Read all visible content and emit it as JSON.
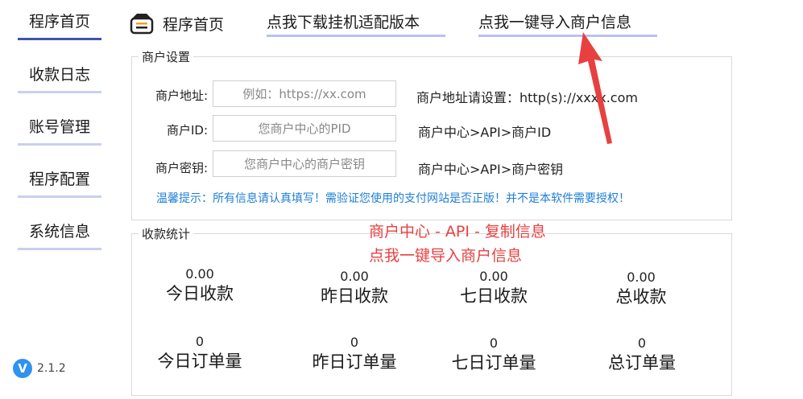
{
  "sidebar": {
    "items": [
      {
        "label": "程序首页",
        "active": true
      },
      {
        "label": "收款日志",
        "active": false
      },
      {
        "label": "账号管理",
        "active": false
      },
      {
        "label": "程序配置",
        "active": false
      },
      {
        "label": "系统信息",
        "active": false
      }
    ],
    "version_badge": "V",
    "version": "2.1.2"
  },
  "topbar": {
    "home_title": "程序首页",
    "download_link": "点我下载挂机适配版本",
    "import_link": "点我一键导入商户信息"
  },
  "merchant": {
    "section_title": "商户设置",
    "address_label": "商户地址:",
    "address_placeholder": "例如：https://xx.com",
    "address_hint": "商户地址请设置：http(s)://xxxx.com",
    "id_label": "商户ID:",
    "id_placeholder": "您商户中心的PID",
    "id_hint": "商户中心>API>商户ID",
    "key_label": "商户密钥:",
    "key_placeholder": "您商户中心的商户密钥",
    "key_hint": "商户中心>API>商户密钥",
    "tip": "温馨提示：所有信息请认真填写！需验证您使用的支付网站是否正版！并不是本软件需要授权！"
  },
  "stats": {
    "section_title": "收款统计",
    "items": [
      {
        "value": "0.00",
        "label": "今日收款"
      },
      {
        "value": "0.00",
        "label": "昨日收款"
      },
      {
        "value": "0.00",
        "label": "七日收款"
      },
      {
        "value": "0.00",
        "label": "总收款"
      },
      {
        "value": "0",
        "label": "今日订单量"
      },
      {
        "value": "0",
        "label": "昨日订单量"
      },
      {
        "value": "0",
        "label": "七日订单量"
      },
      {
        "value": "0",
        "label": "总订单量"
      }
    ]
  },
  "annotation": {
    "line1": "商户中心 - API - 复制信息",
    "line2": "点我一键导入商户信息"
  },
  "colors": {
    "accent": "#3f55a8",
    "underline": "#c9d0ee",
    "tip": "#1e7fd6",
    "annotation": "#e84040",
    "version_badge": "#2f93f0"
  }
}
